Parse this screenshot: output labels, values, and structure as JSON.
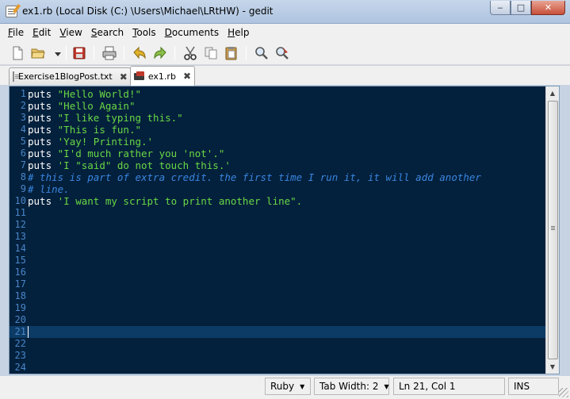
{
  "window": {
    "title": "ex1.rb (Local Disk (C:) \\Users\\Michael\\LRtHW) - gedit",
    "min_glyph": "‒",
    "max_glyph": "□",
    "close_glyph": "✕"
  },
  "menu": [
    {
      "label": "File",
      "key": "F",
      "rest": "ile"
    },
    {
      "label": "Edit",
      "key": "E",
      "rest": "dit"
    },
    {
      "label": "View",
      "key": "V",
      "rest": "iew"
    },
    {
      "label": "Search",
      "key": "S",
      "rest": "earch"
    },
    {
      "label": "Tools",
      "key": "T",
      "rest": "ools"
    },
    {
      "label": "Documents",
      "key": "D",
      "rest": "ocuments"
    },
    {
      "label": "Help",
      "key": "H",
      "rest": "elp"
    }
  ],
  "toolbar": [
    "new-document-icon",
    "open-folder-icon",
    "open-recent-icon",
    "save-icon",
    "print-icon",
    "undo-icon",
    "redo-icon",
    "cut-icon",
    "copy-icon",
    "paste-icon",
    "find-icon",
    "replace-icon"
  ],
  "tabs": [
    {
      "label": "Exercise1BlogPost.txt",
      "close": "✖",
      "active": false
    },
    {
      "label": "ex1.rb",
      "close": "✖",
      "active": true
    }
  ],
  "editor": {
    "line_numbers": [
      "1",
      "2",
      "3",
      "4",
      "5",
      "6",
      "7",
      "8",
      "9",
      "10",
      "11",
      "12",
      "13",
      "14",
      "15",
      "16",
      "17",
      "18",
      "19",
      "20",
      "21",
      "22",
      "23",
      "24"
    ],
    "current_line": 21,
    "colors": {
      "background": "#03203c",
      "string": "#6ad845",
      "comment": "#3b86e0",
      "keyword": "#ffffff",
      "line_number": "#4a86c8",
      "current_line": "#0c3b66"
    },
    "lines": [
      [
        {
          "t": "kw",
          "v": "puts "
        },
        {
          "t": "str",
          "v": "\"Hello World!\""
        }
      ],
      [
        {
          "t": "kw",
          "v": "puts "
        },
        {
          "t": "str",
          "v": "\"Hello Again\""
        }
      ],
      [
        {
          "t": "kw",
          "v": "puts "
        },
        {
          "t": "str",
          "v": "\"I like typing this.\""
        }
      ],
      [
        {
          "t": "kw",
          "v": "puts "
        },
        {
          "t": "str",
          "v": "\"This is fun.\""
        }
      ],
      [
        {
          "t": "kw",
          "v": "puts "
        },
        {
          "t": "str",
          "v": "'Yay! Printing.'"
        }
      ],
      [
        {
          "t": "kw",
          "v": "puts "
        },
        {
          "t": "str",
          "v": "\"I'd much rather you 'not'.\""
        }
      ],
      [
        {
          "t": "kw",
          "v": "puts "
        },
        {
          "t": "str",
          "v": "'I \"said\" do not touch this.'"
        }
      ],
      [
        {
          "t": "cmt",
          "v": "# this is part of extra credit. the first time I run it, it will add another"
        }
      ],
      [
        {
          "t": "cmt",
          "v": "# line."
        }
      ],
      [
        {
          "t": "kw",
          "v": "puts "
        },
        {
          "t": "str",
          "v": "'I want my script to print another line\"."
        }
      ]
    ]
  },
  "scrollbar": {
    "up_glyph": "▲",
    "down_glyph": "▼"
  },
  "status": {
    "language": "Ruby",
    "tab_width": "Tab Width: 2",
    "dropdown_arrow": "▼",
    "position": "Ln 21, Col 1",
    "mode": "INS"
  }
}
